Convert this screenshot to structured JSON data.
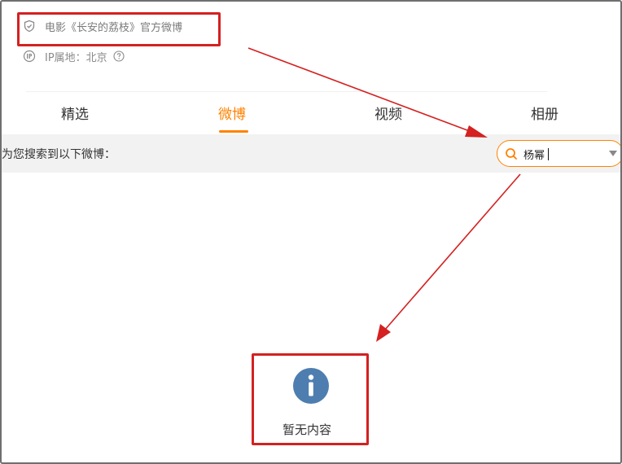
{
  "profile": {
    "verify_text": "电影《长安的荔枝》官方微博",
    "ip_text": "IP属地：北京"
  },
  "tabs": [
    {
      "label": "精选",
      "active": false
    },
    {
      "label": "微博",
      "active": true
    },
    {
      "label": "视频",
      "active": false
    },
    {
      "label": "相册",
      "active": false
    }
  ],
  "search": {
    "hint": "为您搜索到以下微博：",
    "value": "杨幂"
  },
  "empty": {
    "text": "暂无内容"
  },
  "icons": {
    "verify": "shield-icon",
    "ip": "ip-location-icon",
    "help": "question-circle-icon",
    "search": "search-icon",
    "dropdown": "caret-down-icon",
    "empty": "info-circle-icon"
  },
  "colors": {
    "accent": "#ff8200",
    "annotation": "#d42121",
    "info_icon": "#4e7eb0",
    "search_bar_bg": "#f2f2f2"
  }
}
